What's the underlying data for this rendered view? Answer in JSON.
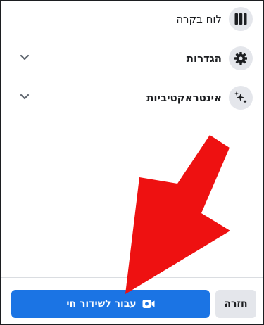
{
  "menu": {
    "items": [
      {
        "label": "לוח בקרה",
        "icon": "dashboard-icon",
        "expandable": false
      },
      {
        "label": "הגדרות",
        "icon": "gear-icon",
        "expandable": true
      },
      {
        "label": "אינטראקטיביות",
        "icon": "sparkle-icon",
        "expandable": true
      }
    ]
  },
  "footer": {
    "go_live_label": "עבור לשידור חי",
    "back_label": "חזרה"
  },
  "colors": {
    "primary": "#1b74e4",
    "arrow": "#ee1111",
    "icon_bg": "#e4e6eb"
  }
}
